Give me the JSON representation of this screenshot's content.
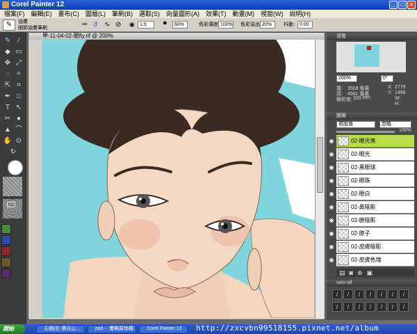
{
  "titlebar": {
    "title": "Corel Painter 12"
  },
  "menu": [
    "檔案(F)",
    "編輯(E)",
    "畫布(C)",
    "圖層(L)",
    "筆刷(B)",
    "選取(S)",
    "向量圖形(A)",
    "效果(T)",
    "動畫(M)",
    "視窗(W)",
    "說明(H)"
  ],
  "propbar": {
    "category": "油畫",
    "variant": "細節油畫筆刷",
    "size_value": "1.5",
    "opacity_value": "60%",
    "resat_label": "色彩濃度:",
    "resat_value": "100%",
    "bleed_label": "色彩溢出:",
    "bleed_value": "20%",
    "jitter_label": "抖動:",
    "jitter_value": "0.00"
  },
  "document": {
    "title": "甲-11-04-02-眼fly.rif @ 200%"
  },
  "navigator": {
    "header": "導覽",
    "zoom": "200%",
    "rotation": "0°",
    "width_label": "寬:",
    "width_value": "3508 像素",
    "height_label": "高:",
    "height_value": "4961 像素",
    "res_label": "解析度:",
    "res_value": "300 PPI",
    "x_label": "X:",
    "x_value": "2779",
    "y_label": "Y:",
    "y_value": "1496",
    "w_label": "W:",
    "h_label": "H:"
  },
  "layers_panel": {
    "header": "圖層",
    "composite": "預設值",
    "method": "忽略",
    "opacity": "100%",
    "layers": [
      "02-眼光亮",
      "02-眼光",
      "02-黑眼球",
      "02-眼珠",
      "02-眼白",
      "02-鼻陰影",
      "02-臉陰影",
      "02-脖子",
      "02-皮膚陰影",
      "02-皮膚色塊"
    ]
  },
  "brush_panel": {
    "header": "uein-all"
  },
  "taskbar": {
    "start": "開始",
    "tasks": [
      "主題(在 佛光山 ...",
      "psd -- 畫稿原始檔",
      "Corel Painter 12"
    ]
  },
  "watermark": "http://zxcvbn99518155.pixnet.net/album",
  "colors": {
    "canvas_bg": "#7ed6dc",
    "hair": "#3a2a22",
    "skin": "#f3d8c4",
    "selected_layer": "#b6e043"
  }
}
